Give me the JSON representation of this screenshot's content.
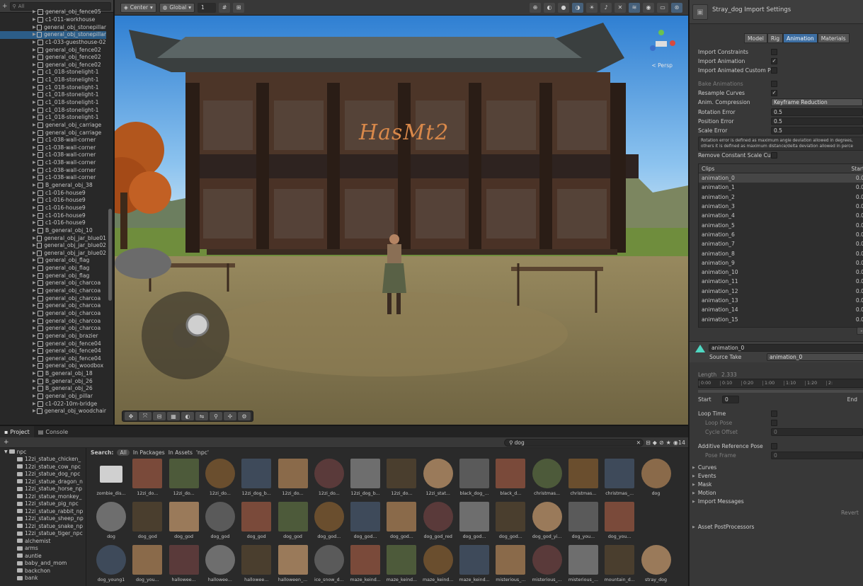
{
  "hierarchy": {
    "search_placeholder": "All",
    "items": [
      "general_obj_fence05",
      "c1-011-workhouse",
      "general_obj_stonepillar",
      "general_obj_stonepillar",
      "c1-033-guesthouse-02",
      "general_obj_fence02",
      "general_obj_fence02",
      "general_obj_fence02",
      "c1_018-stonelight-1",
      "c1_018-stonelight-1",
      "c1_018-stonelight-1",
      "c1_018-stonelight-1",
      "c1_018-stonelight-1",
      "c1_018-stonelight-1",
      "c1_018-stonelight-1",
      "general_obj_carriage",
      "general_obj_carriage",
      "c1-038-wall-corner",
      "c1-038-wall-corner",
      "c1-038-wall-corner",
      "c1-038-wall-corner",
      "c1-038-wall-corner",
      "c1-038-wall-corner",
      "B_general_obj_38",
      "c1-016-house9",
      "c1-016-house9",
      "c1-016-house9",
      "c1-016-house9",
      "c1-016-house9",
      "B_general_obj_10",
      "general_obj_jar_blue01",
      "general_obj_jar_blue02",
      "general_obj_jar_blue02",
      "general_obj_flag",
      "general_obj_flag",
      "general_obj_flag",
      "general_obj_charcoa",
      "general_obj_charcoa",
      "general_obj_charcoa",
      "general_obj_charcoa",
      "general_obj_charcoa",
      "general_obj_charcoa",
      "general_obj_charcoa",
      "general_obj_brazier",
      "general_obj_fence04",
      "general_obj_fence04",
      "general_obj_fence04",
      "general_obj_woodbox",
      "B_general_obj_18",
      "B_general_obj_26",
      "B_general_obj_26",
      "general_obj_pillar",
      "c1-022-10m-bridge",
      "general_obj_woodchair"
    ],
    "selected_index": 3
  },
  "scene": {
    "pivot_label": "Center",
    "space_label": "Global",
    "grid_value": "1",
    "signboard": "HasMt2",
    "persp_label": "< Persp"
  },
  "inspector": {
    "title": "Stray_dog Import Settings",
    "tabs": [
      "Model",
      "Rig",
      "Animation",
      "Materials"
    ],
    "active_tab": "Animation",
    "props": {
      "import_constraints": "Import Constraints",
      "import_animation": "Import Animation",
      "import_animated_custom": "Import Animated Custom P",
      "bake_animations": "Bake Animations",
      "resample_curves": "Resample Curves",
      "anim_compression": "Anim. Compression",
      "anim_compression_value": "Keyframe Reduction",
      "rotation_error": "Rotation Error",
      "rotation_error_value": "0.5",
      "position_error": "Position Error",
      "position_error_value": "0.5",
      "scale_error": "Scale Error",
      "scale_error_value": "0.5",
      "help_line1": "Rotation error is defined as maximum angle deviation allowed in degrees, ",
      "help_line2": "others it is defined as maximum distance/delta deviation allowed in perce",
      "remove_constant": "Remove Constant Scale Cu"
    },
    "clips_header": "Clips",
    "clips_start_header": "Start",
    "clips": [
      "animation_0",
      "animation_1",
      "animation_2",
      "animation_3",
      "animation_4",
      "animation_5",
      "animation_6",
      "animation_7",
      "animation_8",
      "animation_9",
      "animation_10",
      "animation_11",
      "animation_12",
      "animation_13",
      "animation_14",
      "animation_15"
    ],
    "clip_start_value": "0.0",
    "clip_name": "animation_0",
    "source_take_label": "Source Take",
    "source_take_value": "animation_0",
    "length_label": "Length",
    "length_value": "2.333",
    "timeline_ticks": [
      "0:00",
      "0:10",
      "0:20",
      "1:00",
      "1:10",
      "1:20",
      "2:"
    ],
    "start_label": "Start",
    "start_value": "0",
    "end_label": "End",
    "loop_time": "Loop Time",
    "loop_pose": "Loop Pose",
    "cycle_offset": "Cycle Offset",
    "cycle_offset_value": "0",
    "additive_ref": "Additive Reference Pose",
    "pose_frame": "Pose Frame",
    "pose_frame_value": "0",
    "sections": [
      "Curves",
      "Events",
      "Mask",
      "Motion",
      "Import Messages"
    ],
    "revert_label": "Revert",
    "postprocessors": "Asset PostProcessors"
  },
  "project": {
    "tabs": [
      "Project",
      "Console"
    ],
    "search_value": "dog",
    "count_badge": "14",
    "search_label": "Search:",
    "scopes": [
      "All",
      "In Packages",
      "In Assets",
      "'npc'"
    ],
    "root_folder": "npc",
    "folders": [
      "12zi_statue_chicken_",
      "12zi_statue_cow_npc",
      "12zi_statue_dog_npc",
      "12zi_statue_dragon_n",
      "12zi_statue_horse_np",
      "12zi_statue_monkey_",
      "12zi_statue_pig_npc",
      "12zi_statue_rabbit_np",
      "12zi_statue_sheep_np",
      "12zi_statue_snake_np",
      "12zi_statue_tiger_npc",
      "alchemist",
      "arms",
      "auntie",
      "baby_and_mom",
      "backchon",
      "bank"
    ],
    "assets_row1": [
      "zombie_dis...",
      "12zi_do...",
      "12zi_do...",
      "12zi_do...",
      "12zi_dog_b...",
      "12zi_do...",
      "12zi_do...",
      "12zi_dog_b...",
      "12zi_do...",
      "12zi_stat...",
      "black_dog_...",
      "black_d...",
      "christmas...",
      "christmas...",
      "christmas_...",
      "dog"
    ],
    "assets_row2": [
      "dog",
      "dog_god",
      "dog_god",
      "dog_god",
      "dog_god",
      "dog_god",
      "dog_god...",
      "dog_god...",
      "dog_god...",
      "dog_god_red",
      "dog_god...",
      "dog_god...",
      "dog_god_yi...",
      "dog_you...",
      "dog_you..."
    ],
    "assets_row3": [
      "dog_young1",
      "dog_you...",
      "hallowee...",
      "hallowee...",
      "hallowee...",
      "halloween_...",
      "ice_snow_d...",
      "maze_keind...",
      "maze_keind...",
      "maze_keind...",
      "maze_keind...",
      "misterious_...",
      "misterious_...",
      "misterious_...",
      "mountain_d...",
      "stray_dog"
    ]
  }
}
